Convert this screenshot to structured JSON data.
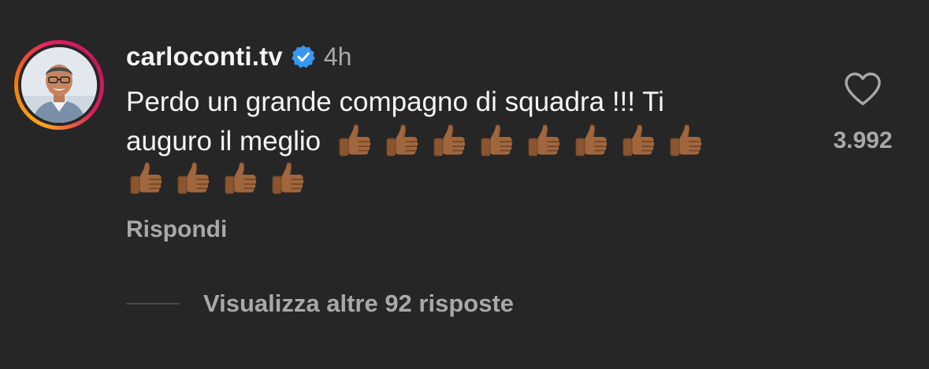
{
  "comment": {
    "username": "carloconti.tv",
    "time_ago": "4h",
    "text_line1": "Perdo un grande compagno di squadra !!! Ti",
    "text_line2": "auguro il meglio",
    "emoji_icon": "thumbs-up-medium-dark-skin-tone",
    "emoji_count_line2": 8,
    "emoji_count_line3": 4,
    "reply_label": "Rispondi",
    "like_count": "3.992",
    "view_replies_label": "Visualizza altre 92 risposte"
  },
  "colors": {
    "background": "#262626",
    "primary_text": "#f5f5f5",
    "secondary_text": "#a8a8a8",
    "verified_blue": "#3897f0"
  }
}
